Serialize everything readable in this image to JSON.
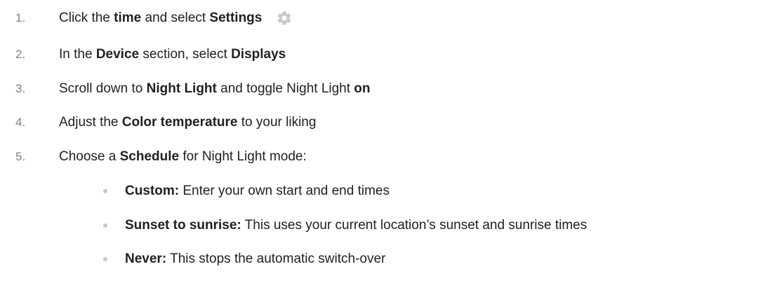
{
  "steps": [
    {
      "number": "1.",
      "parts": [
        {
          "text": "Click the ",
          "bold": false
        },
        {
          "text": "time",
          "bold": true
        },
        {
          "text": " and select ",
          "bold": false
        },
        {
          "text": "Settings",
          "bold": true
        }
      ],
      "icon": "gear-icon"
    },
    {
      "number": "2.",
      "parts": [
        {
          "text": "In the ",
          "bold": false
        },
        {
          "text": "Device",
          "bold": true
        },
        {
          "text": " section, select ",
          "bold": false
        },
        {
          "text": "Displays",
          "bold": true
        }
      ]
    },
    {
      "number": "3.",
      "parts": [
        {
          "text": "Scroll down to ",
          "bold": false
        },
        {
          "text": "Night Light",
          "bold": true
        },
        {
          "text": " and toggle Night Light ",
          "bold": false
        },
        {
          "text": "on",
          "bold": true
        }
      ]
    },
    {
      "number": "4.",
      "parts": [
        {
          "text": "Adjust the ",
          "bold": false
        },
        {
          "text": "Color temperature",
          "bold": true
        },
        {
          "text": " to your liking",
          "bold": false
        }
      ]
    },
    {
      "number": "5.",
      "parts": [
        {
          "text": "Choose a ",
          "bold": false
        },
        {
          "text": "Schedule",
          "bold": true
        },
        {
          "text": " for Night Light mode:",
          "bold": false
        }
      ]
    }
  ],
  "bullets": [
    {
      "label": "Custom:",
      "text": " Enter your own start and end times"
    },
    {
      "label": "Sunset to sunrise:",
      "text": " This uses your current location’s sunset and sunrise times"
    },
    {
      "label": "Never:",
      "text": " This stops the automatic switch-over"
    }
  ],
  "colors": {
    "text": "#202124",
    "number": "#7d8084",
    "bullet": "#c6c9cc",
    "icon": "#c6c9cc"
  }
}
